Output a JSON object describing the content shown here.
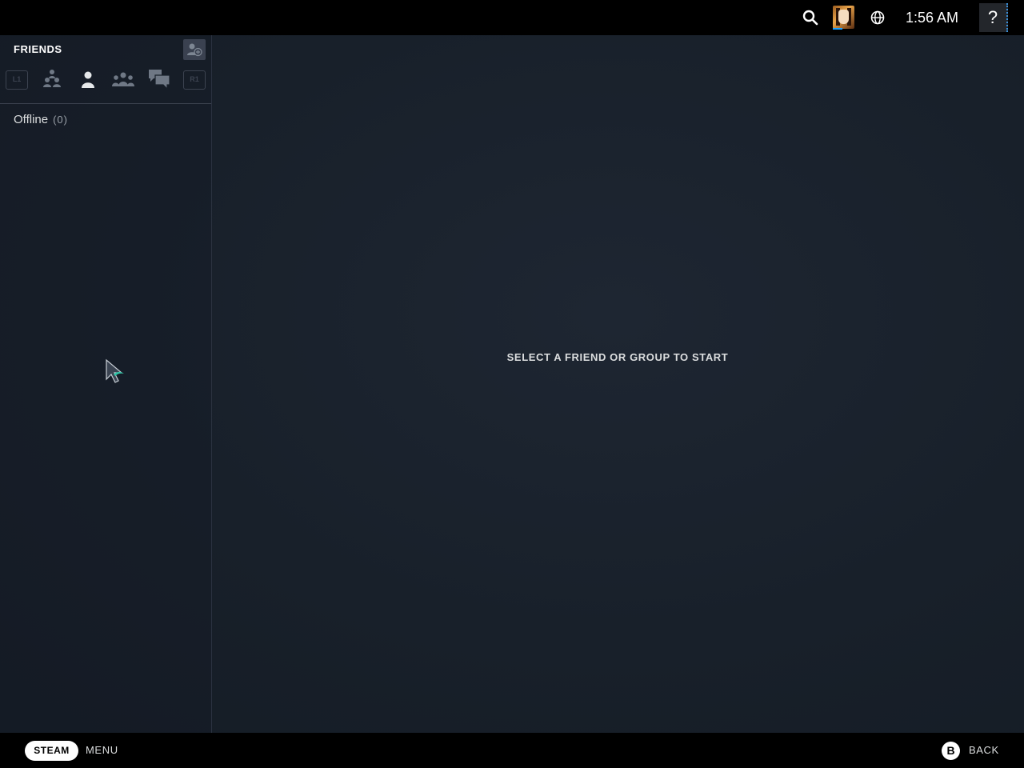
{
  "topbar": {
    "clock": "1:56 AM",
    "help_label": "?",
    "search_icon": "search-icon",
    "globe_icon": "globe-icon",
    "accent": "#1a9fff"
  },
  "sidebar": {
    "title": "FRIENDS",
    "left_bumper": "L1",
    "right_bumper": "R1",
    "tabs": [
      {
        "icon": "friends-ingame-icon"
      },
      {
        "icon": "friend-icon",
        "active": true
      },
      {
        "icon": "groups-icon"
      },
      {
        "icon": "chat-icon"
      }
    ],
    "section": {
      "label": "Offline",
      "count": "(0)"
    }
  },
  "main": {
    "empty_message": "SELECT A FRIEND OR GROUP TO START"
  },
  "bottombar": {
    "steam_label": "STEAM",
    "menu_label": "MENU",
    "b_label": "B",
    "back_label": "BACK"
  },
  "colors": {
    "background": "#18202a",
    "text": "#dcdedf"
  }
}
